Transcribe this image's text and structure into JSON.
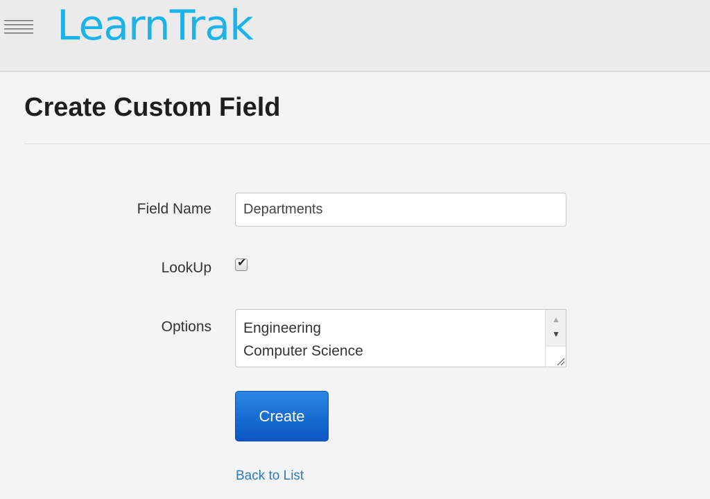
{
  "header": {
    "brand": "LearnTrak",
    "brand_color": "#1ab4ea",
    "menu_icon": "hamburger-menu-icon"
  },
  "page": {
    "title": "Create Custom Field"
  },
  "form": {
    "field_name": {
      "label": "Field Name",
      "value": "Departments"
    },
    "lookup": {
      "label": "LookUp",
      "checked": true
    },
    "options": {
      "label": "Options",
      "lines": [
        "Engineering",
        "Computer Science"
      ]
    },
    "submit_label": "Create",
    "submit_color": "#0a56c4"
  },
  "footer": {
    "back_link": "Back to List",
    "link_color": "#2a7ac0"
  }
}
